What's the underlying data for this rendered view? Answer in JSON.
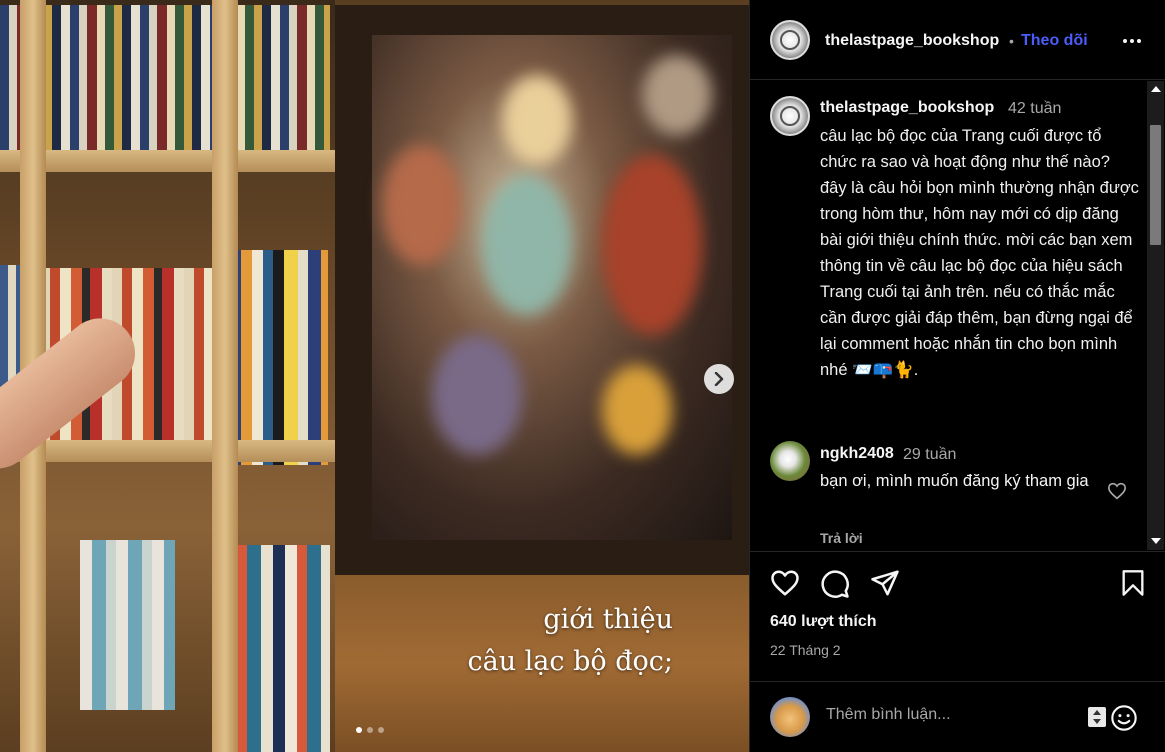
{
  "post": {
    "username": "thelastpage_bookshop",
    "separator": "•",
    "follow_label": "Theo dõi",
    "more_label": "•••"
  },
  "media": {
    "caption_line1": "giới thiệu",
    "caption_line2": "câu lạc bộ đọc;",
    "slide_count": 3,
    "active_slide": 1
  },
  "caption": {
    "author": "thelastpage_bookshop",
    "time": "42 tuần",
    "text": "câu lạc bộ đọc của Trang cuối được tổ chức ra sao và hoạt động như thế nào? đây là câu hỏi bọn mình thường nhận được trong hòm thư, hôm nay mới có dịp đăng bài giới thiệu chính thức. mời các bạn xem thông tin về câu lạc bộ đọc của hiệu sách Trang cuối tại ảnh trên. nếu có thắc mắc cần được giải đáp thêm, bạn đừng ngại để lại comment hoặc nhắn tin cho bọn mình nhé 📨📪🐈."
  },
  "comment": {
    "author": "ngkh2408",
    "time": "29 tuần",
    "text": "bạn ơi, mình muốn đăng ký tham gia",
    "reply_label": "Trả lời"
  },
  "stats": {
    "likes": "640 lượt thích",
    "date": "22 Tháng 2"
  },
  "composer": {
    "placeholder": "Thêm bình luận..."
  },
  "colors": {
    "accent": "#4a5df9",
    "background": "#000000",
    "muted": "#a8a8a8"
  }
}
